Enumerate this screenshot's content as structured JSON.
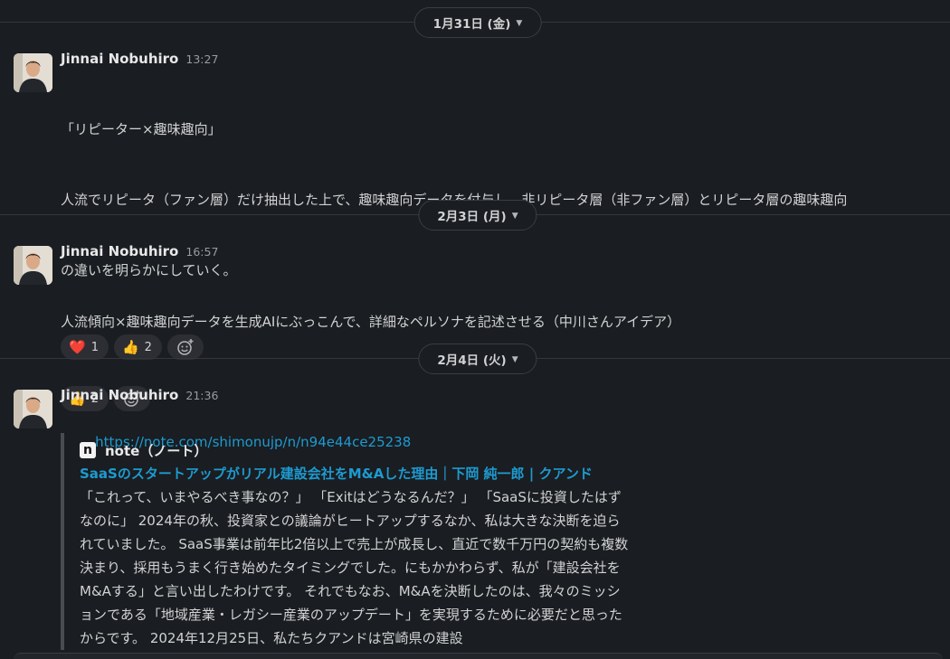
{
  "days": [
    {
      "label": "1月31日 (金)"
    },
    {
      "label": "2月3日 (月)"
    },
    {
      "label": "2月4日 (火)"
    }
  ],
  "messages": [
    {
      "author": "Jinnai Nobuhiro",
      "time": "13:27",
      "lines": [
        "「リピーター×趣味趣向」",
        "人流でリピータ（ファン層）だけ抽出した上で、趣味趣向データを付与し、非リピータ層（非ファン層）とリピータ層の趣味趣向",
        "の違いを明らかにしていく。"
      ],
      "reactions": [
        {
          "emoji": "❤️",
          "icon": "heart-icon",
          "count": "1"
        },
        {
          "emoji": "👍",
          "icon": "thumbs-up-icon",
          "count": "2"
        }
      ]
    },
    {
      "author": "Jinnai Nobuhiro",
      "time": "16:57",
      "lines": [
        "人流傾向×趣味趣向データを生成AIにぶっこんで、詳細なペルソナを記述させる（中川さんアイデア）"
      ],
      "reactions": [
        {
          "emoji": "👍",
          "icon": "thumbs-up-icon",
          "count": "2"
        }
      ]
    },
    {
      "author": "Jinnai Nobuhiro",
      "time": "21:36",
      "link": "https://note.com/shimonujp/n/n94e44ce25238",
      "unfurl": {
        "site_icon": "n",
        "site_name": "note（ノート）",
        "title": "SaaSのスタートアップがリアル建設会社をM&Aした理由｜下岡 純一郎 | クアンド",
        "lines": [
          "「これって、いまやるべき事なの？」 「Exitはどうなるんだ？」 「SaaSに投資したはず",
          "なのに」 2024年の秋、投資家との議論がヒートアップするなか、私は大きな決断を迫ら",
          "れていました。 SaaS事業は前年比2倍以上で売上が成長し、直近で数千万円の契約も複数",
          "決まり、採用もうまく行き始めたタイミングでした。にもかかわらず、私が「建設会社を",
          "M&Aする」と言い出したわけです。 それでもなお、M&Aを決断したのは、我々のミッシ",
          "ョンである「地域産業・レガシー産業のアップデート」を実現するために必要だと思った",
          "からです。 2024年12月25日、私たちクアンドは宮崎県の建設"
        ]
      }
    }
  ],
  "icons": {
    "add_reaction": "add-reaction-icon",
    "chevron": "chevron-down-icon"
  },
  "colors": {
    "background": "#1a1d21",
    "link": "#1d9bd1",
    "text": "#d1d2d3",
    "reaction_bg": "#2c2e33"
  }
}
